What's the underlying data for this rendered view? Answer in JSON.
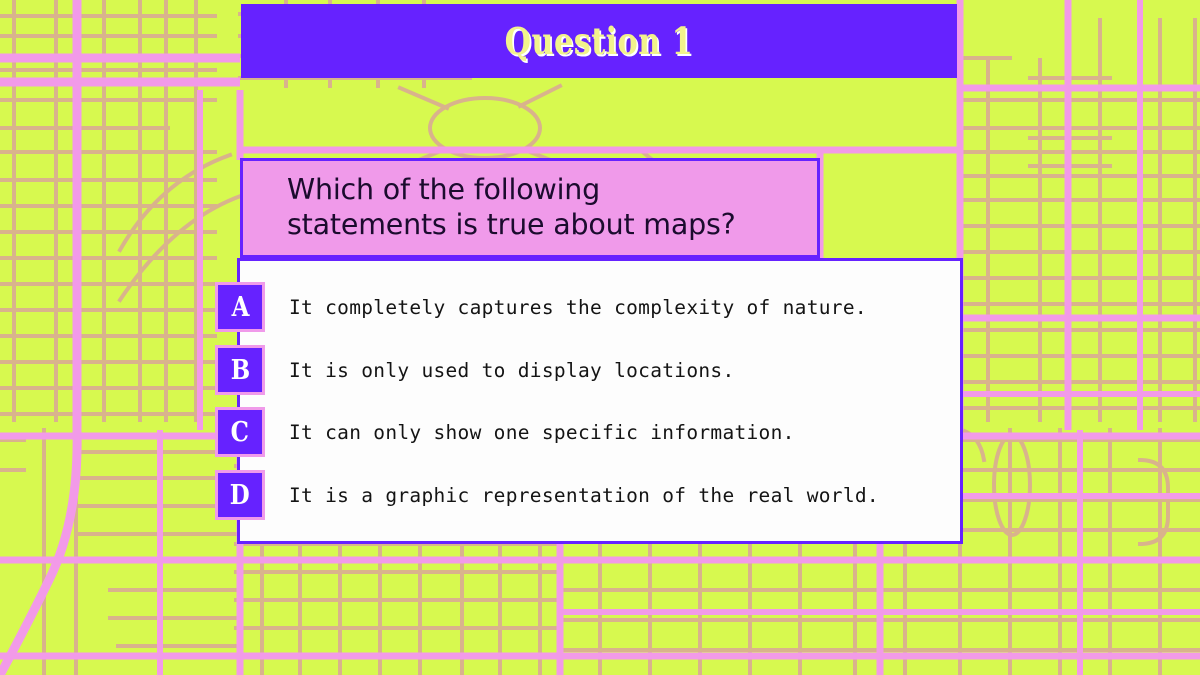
{
  "slide": {
    "title": "Question 1",
    "background_theme": "city-street-map",
    "colors": {
      "map_base": "#D7F94F",
      "major_road": "#F29AE8",
      "minor_road": "#D9B38C",
      "accent_purple": "#6622FF",
      "accent_pink": "#F09AEA",
      "title_text": "#F2F28C",
      "panel_white": "#FDFDFD",
      "body_text": "#141414"
    }
  },
  "question": {
    "text": "Which of the following\nstatements is true about maps?"
  },
  "answers": [
    {
      "letter": "A",
      "text": "It completely captures the complexity of nature."
    },
    {
      "letter": "B",
      "text": "It is only used to display locations."
    },
    {
      "letter": "C",
      "text": "It can only show one specific information."
    },
    {
      "letter": "D",
      "text": "It is a graphic representation of the real world."
    }
  ]
}
